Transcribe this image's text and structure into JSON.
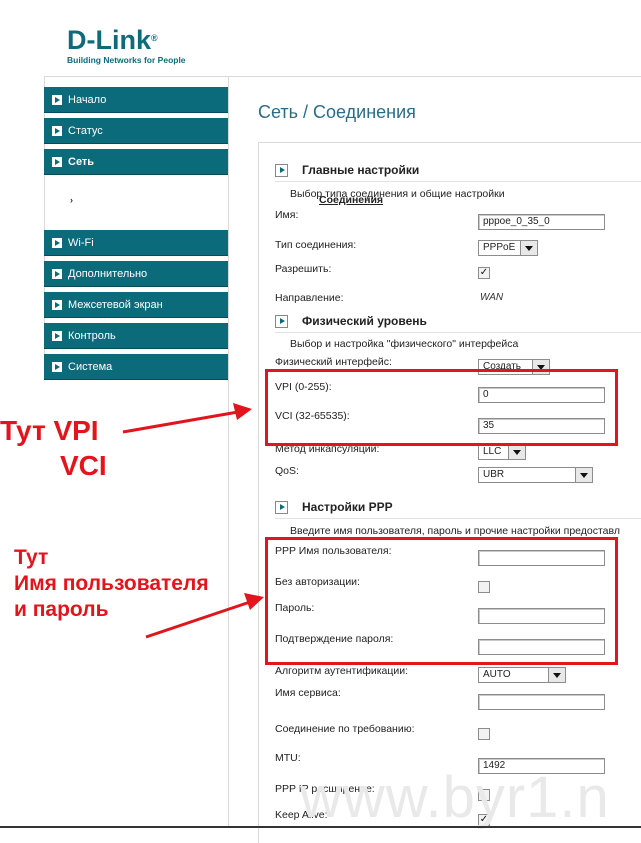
{
  "logo": {
    "brand": "D-Link",
    "reg": "®",
    "tagline": "Building Networks for People"
  },
  "sidebar": {
    "items": [
      {
        "label": "Начало"
      },
      {
        "label": "Статус"
      },
      {
        "label": "Сеть"
      },
      {
        "label": "Wi-Fi"
      },
      {
        "label": "Дополнительно"
      },
      {
        "label": "Межсетевой экран"
      },
      {
        "label": "Контроль"
      },
      {
        "label": "Система"
      }
    ],
    "sub_bullet": "›",
    "sub_label": "Соединения"
  },
  "main": {
    "breadcrumb": "Сеть / Соединения",
    "general": {
      "title": "Главные настройки",
      "desc": "Выбор типа соединения и общие настройки",
      "name_label": "Имя:",
      "name_value": "pppoe_0_35_0",
      "conn_type_label": "Тип соединения:",
      "conn_type_value": "PPPoE",
      "enable_label": "Разрешить:",
      "enable_check": "✓",
      "direction_label": "Направление:",
      "direction_value": "WAN"
    },
    "physical": {
      "title": "Физический уровень",
      "desc": "Выбор и настройка \"физического\" интерфейса",
      "iface_label": "Физический интерфейс:",
      "iface_value": "Создать",
      "vpi_label": "VPI (0-255):",
      "vpi_value": "0",
      "vci_label": "VCI (32-65535):",
      "vci_value": "35",
      "encap_label": "Метод инкапсуляции:",
      "encap_value": "LLC",
      "qos_label": "QoS:",
      "qos_value": "UBR"
    },
    "ppp": {
      "title": "Настройки PPP",
      "desc": "Введите имя пользователя, пароль и прочие настройки предоставл",
      "user_label": "PPP Имя пользователя:",
      "noauth_label": "Без авторизации:",
      "pass_label": "Пароль:",
      "confirm_label": "Подтверждение пароля:",
      "auth_algo_label": "Алгоритм аутентификации:",
      "auth_algo_value": "AUTO",
      "service_label": "Имя сервиса:",
      "on_demand_label": "Соединение по требованию:",
      "mtu_label": "MTU:",
      "mtu_value": "1492",
      "ppp_ip_ext_label": "PPP IP расширение:",
      "keepalive_label": "Keep Alive:",
      "keepalive_check": "✓"
    }
  },
  "annotations": {
    "vpi_line1": "Тут VPI",
    "vpi_line2": "VCI",
    "user_line1": "Тут",
    "user_line2": "Имя пользователя",
    "user_line3": "и пароль",
    "color": "#e2141c"
  },
  "watermark": "www.byr1.n",
  "colors": {
    "accent": "#0c6b7b",
    "title": "#2a6c86"
  }
}
